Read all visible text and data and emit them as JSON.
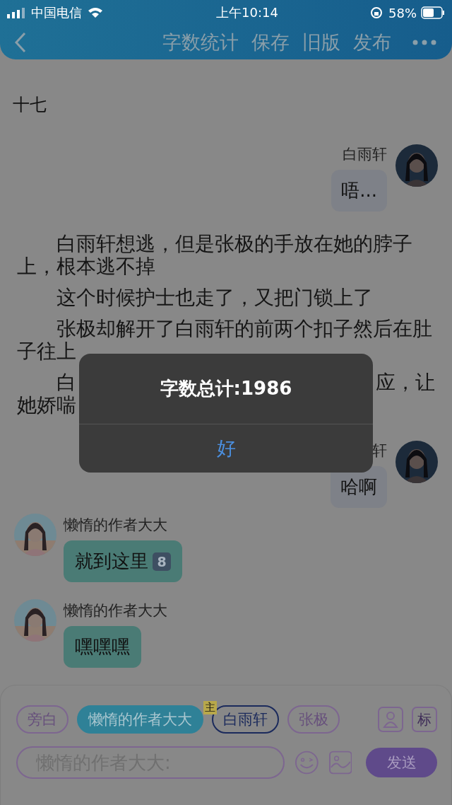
{
  "status_bar": {
    "carrier": "中国电信",
    "time": "上午10:14",
    "battery": "58%"
  },
  "header": {
    "actions": [
      "字数统计",
      "保存",
      "旧版",
      "发布"
    ]
  },
  "chapter_title": "十七",
  "content": [
    {
      "kind": "right",
      "name": "白雨轩",
      "text": "唔..."
    },
    {
      "kind": "narration",
      "text": "白雨轩想逃，但是张极的手放在她的脖子上，根本逃不掉"
    },
    {
      "kind": "narration",
      "text": "这个时候护士也走了，又把门锁上了"
    },
    {
      "kind": "narration",
      "text": "张极却解开了白雨轩的前两个扣子然后在肚子往上"
    },
    {
      "kind": "covered",
      "left_lines": [
        "白",
        "她娇喘"
      ],
      "right_text": "应，让"
    },
    {
      "kind": "right",
      "name": "轩",
      "text": "哈啊"
    },
    {
      "kind": "left",
      "name": "懒惰的作者大大",
      "text": "就到这里",
      "badge": "8"
    },
    {
      "kind": "left",
      "name": "懒惰的作者大大",
      "text": "嘿嘿嘿"
    }
  ],
  "alert": {
    "title": "字数总计:1986",
    "button": "好"
  },
  "characters": [
    {
      "label": "旁白",
      "selected": false
    },
    {
      "label": "懒惰的作者大大",
      "selected": true
    },
    {
      "label": "白雨轩",
      "selected": false,
      "tag": "主"
    },
    {
      "label": "张极",
      "selected": false
    }
  ],
  "tag_button": "标",
  "input": {
    "placeholder": "懒惰的作者大大:"
  },
  "send": "发送"
}
